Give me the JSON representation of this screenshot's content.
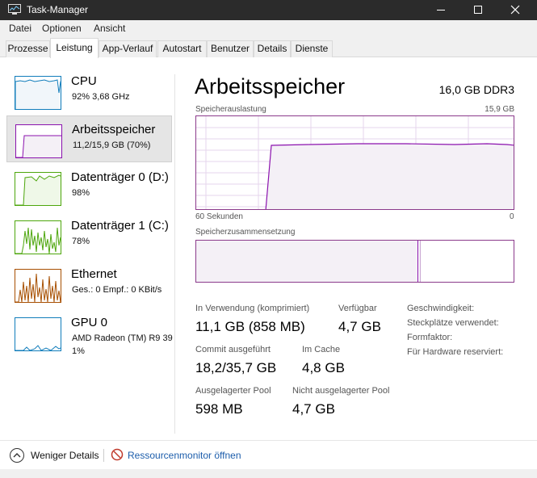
{
  "window": {
    "title": "Task-Manager"
  },
  "menu": [
    "Datei",
    "Optionen",
    "Ansicht"
  ],
  "tabs": [
    "Prozesse",
    "Leistung",
    "App-Verlauf",
    "Autostart",
    "Benutzer",
    "Details",
    "Dienste"
  ],
  "active_tab": "Leistung",
  "sidebar": {
    "items": [
      {
        "name": "CPU",
        "sub": "92%  3,68 GHz",
        "color": "#117dbb"
      },
      {
        "name": "Arbeitsspeicher",
        "sub": "11,2/15,9 GB (70%)",
        "color": "#8b12ae",
        "selected": true
      },
      {
        "name": "Datenträger 0 (D:)",
        "sub": "98%",
        "color": "#4da60c"
      },
      {
        "name": "Datenträger 1 (C:)",
        "sub": "78%",
        "color": "#4da60c"
      },
      {
        "name": "Ethernet",
        "sub": "Ges.: 0  Empf.: 0 KBit/s",
        "color": "#a74f01"
      },
      {
        "name": "GPU 0",
        "sub": "AMD Radeon (TM) R9 39",
        "sub2": "1%",
        "color": "#117dbb"
      }
    ]
  },
  "main": {
    "title": "Arbeitsspeicher",
    "hardware": "16,0 GB DDR3",
    "usage_graph": {
      "label": "Speicherauslastung",
      "max_label": "15,9 GB",
      "time_left": "60 Sekunden",
      "time_right": "0"
    },
    "composition": {
      "label": "Speicherzusammensetzung"
    },
    "stats": {
      "in_use_label": "In Verwendung (komprimiert)",
      "in_use_value": "11,1 GB (858 MB)",
      "available_label": "Verfügbar",
      "available_value": "4,7 GB",
      "commit_label": "Commit ausgeführt",
      "commit_value": "18,2/35,7 GB",
      "cache_label": "Im Cache",
      "cache_value": "4,8 GB",
      "paged_label": "Ausgelagerter Pool",
      "paged_value": "598 MB",
      "nonpaged_label": "Nicht ausgelagerter Pool",
      "nonpaged_value": "4,7 GB"
    },
    "details": [
      "Geschwindigkeit:",
      "Steckplätze verwendet:",
      "Formfaktor:",
      "Für Hardware reserviert:"
    ]
  },
  "footer": {
    "fewer_details": "Weniger Details",
    "resource_monitor": "Ressourcenmonitor öffnen"
  },
  "colors": {
    "memory": "#8b12ae",
    "memory_fill": "#f4f0f6"
  }
}
